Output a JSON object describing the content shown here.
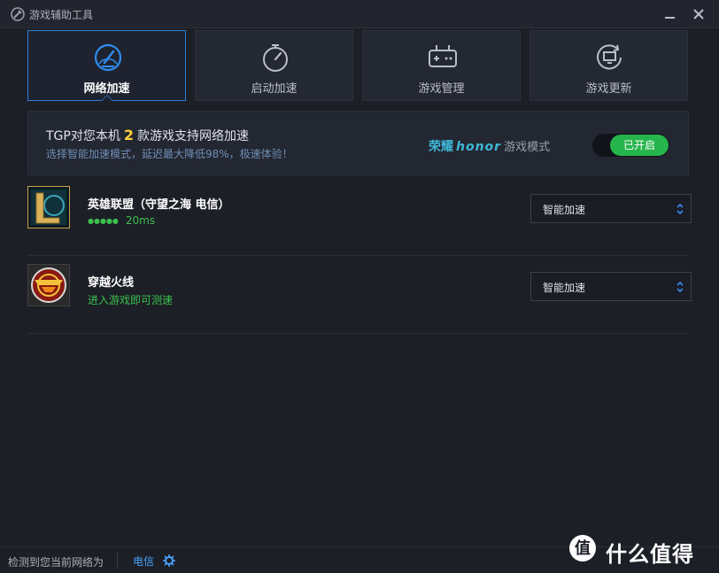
{
  "window": {
    "title": "游戏辅助工具"
  },
  "tabs": [
    {
      "label": "网络加速",
      "icon": "speedometer-icon",
      "active": true
    },
    {
      "label": "启动加速",
      "icon": "stopwatch-icon",
      "active": false
    },
    {
      "label": "游戏管理",
      "icon": "gamepad-icon",
      "active": false
    },
    {
      "label": "游戏更新",
      "icon": "monitor-refresh-icon",
      "active": false
    }
  ],
  "banner": {
    "line1_prefix": "TGP对您本机",
    "count": "2",
    "line1_suffix": "款游戏支持网络加速",
    "line2": "选择智能加速模式，延迟最大降低98%，极速体验！",
    "honor_cn": "荣耀",
    "honor_brand": "honor",
    "honor_mode": "游戏模式",
    "toggle_label": "已开启"
  },
  "games": [
    {
      "name": "英雄联盟（守望之海 电信）",
      "status_dots": "●●●●●",
      "status": "20ms",
      "mode": "智能加速",
      "icon": "league-of-legends-icon"
    },
    {
      "name": "穿越火线",
      "status_dots": "",
      "status": "进入游戏即可测速",
      "mode": "智能加速",
      "icon": "crossfire-icon"
    }
  ],
  "statusbar": {
    "text": "检测到您当前网络为",
    "network": "电信"
  },
  "watermark": {
    "text": "什么值得买"
  },
  "colors": {
    "accent": "#2f7fd6",
    "toggle_on": "#26b54c",
    "count": "#ffd23a",
    "latency": "#3cc04f"
  }
}
